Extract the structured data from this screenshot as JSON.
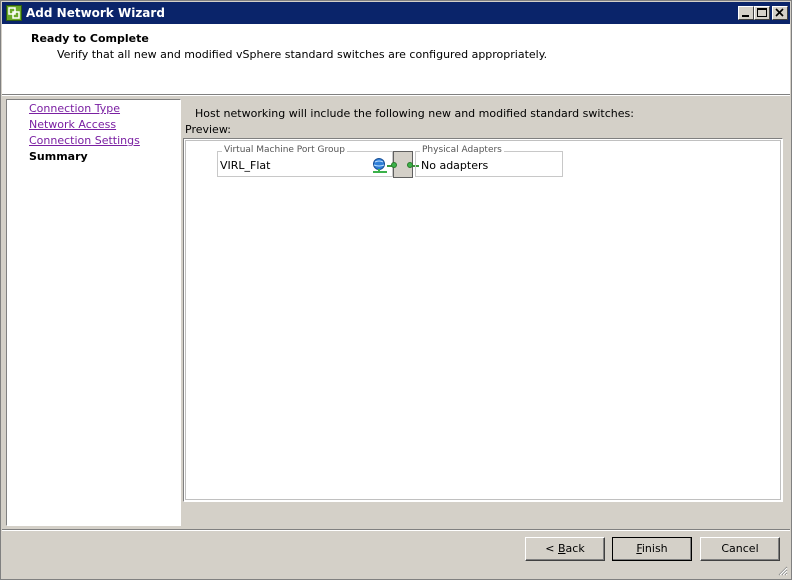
{
  "window": {
    "title": "Add Network Wizard",
    "controls": {
      "minimize": "minimize",
      "maximize": "maximize",
      "close": "close"
    }
  },
  "header": {
    "title": "Ready to Complete",
    "subtitle": "Verify that all new and modified vSphere standard switches are configured appropriately."
  },
  "steps": [
    {
      "label": "Connection Type",
      "state": "link"
    },
    {
      "label": "Network Access",
      "state": "link"
    },
    {
      "label": "Connection Settings",
      "state": "link"
    },
    {
      "label": "Summary",
      "state": "current"
    }
  ],
  "main": {
    "intro": "Host networking will include the following new and modified standard switches:",
    "preview_label": "Preview:",
    "port_group": {
      "legend": "Virtual Machine Port Group",
      "name": "VIRL_Flat"
    },
    "physical_adapters": {
      "legend": "Physical Adapters",
      "value": "No adapters"
    }
  },
  "buttons": {
    "back_accel": "B",
    "back_rest": "ack",
    "back_prefix": "< ",
    "finish_accel": "F",
    "finish_rest": "inish",
    "cancel": "Cancel"
  },
  "colors": {
    "titlebar": "#0a246a",
    "link": "#7a1fa2",
    "connector": "#3bb14a"
  }
}
